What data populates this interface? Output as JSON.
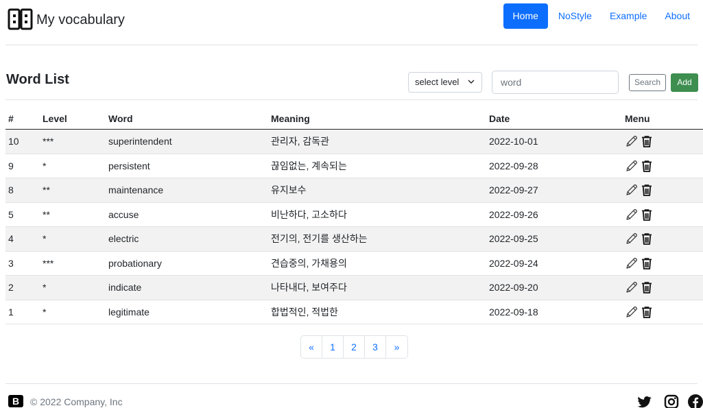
{
  "header": {
    "brand_title": "My vocabulary",
    "nav": [
      {
        "label": "Home",
        "active": true
      },
      {
        "label": "NoStyle",
        "active": false
      },
      {
        "label": "Example",
        "active": false
      },
      {
        "label": "About",
        "active": false
      }
    ]
  },
  "toolbar": {
    "title": "Word List",
    "level_select": "select level",
    "word_placeholder": "word",
    "search_label": "Search",
    "add_label": "Add"
  },
  "table": {
    "headers": [
      "#",
      "Level",
      "Word",
      "Meaning",
      "Date",
      "Menu"
    ],
    "rows": [
      {
        "num": "10",
        "level": "***",
        "word": "superintendent",
        "meaning": "관리자, 감독관",
        "date": "2022-10-01"
      },
      {
        "num": "9",
        "level": "*",
        "word": "persistent",
        "meaning": "끊임없는, 계속되는",
        "date": "2022-09-28"
      },
      {
        "num": "8",
        "level": "**",
        "word": "maintenance",
        "meaning": "유지보수",
        "date": "2022-09-27"
      },
      {
        "num": "5",
        "level": "**",
        "word": "accuse",
        "meaning": "비난하다, 고소하다",
        "date": "2022-09-26"
      },
      {
        "num": "4",
        "level": "*",
        "word": "electric",
        "meaning": "전기의, 전기를 생산하는",
        "date": "2022-09-25"
      },
      {
        "num": "3",
        "level": "***",
        "word": "probationary",
        "meaning": "견습중의, 가채용의",
        "date": "2022-09-24"
      },
      {
        "num": "2",
        "level": "*",
        "word": "indicate",
        "meaning": "나타내다, 보여주다",
        "date": "2022-09-20"
      },
      {
        "num": "1",
        "level": "*",
        "word": "legitimate",
        "meaning": "합법적인, 적법한",
        "date": "2022-09-18"
      }
    ],
    "row_icons": [
      "pencil-icon",
      "trash-icon"
    ]
  },
  "pagination": [
    "«",
    "1",
    "2",
    "3",
    "»"
  ],
  "footer": {
    "logo_letter": "B",
    "copyright": "© 2022 Company, Inc",
    "social_icons": [
      "twitter-icon",
      "instagram-icon",
      "facebook-icon"
    ]
  },
  "colors": {
    "primary": "#0d6efd",
    "success": "#3e8e4f",
    "stripe": "#f2f2f2"
  }
}
